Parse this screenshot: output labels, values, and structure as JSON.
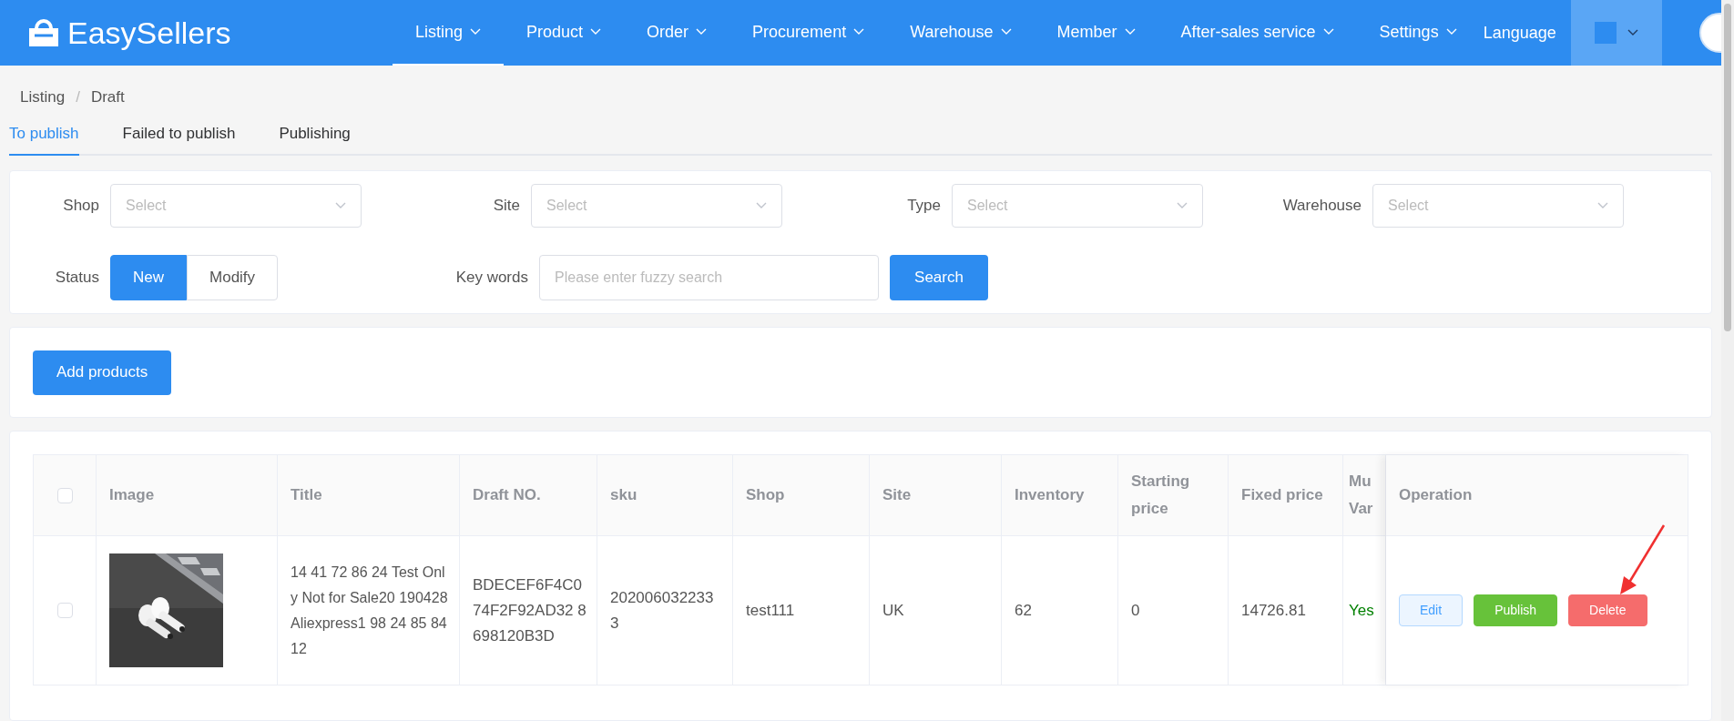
{
  "header": {
    "logo": "EasySellers",
    "nav": [
      {
        "label": "Listing",
        "selected": true
      },
      {
        "label": "Product",
        "selected": false
      },
      {
        "label": "Order",
        "selected": false
      },
      {
        "label": "Procurement",
        "selected": false
      },
      {
        "label": "Warehouse",
        "selected": false
      },
      {
        "label": "Member",
        "selected": false
      },
      {
        "label": "After-sales service",
        "selected": false
      },
      {
        "label": "Settings",
        "selected": false
      }
    ],
    "language": "Language"
  },
  "breadcrumb": {
    "items": [
      "Listing",
      "Draft"
    ],
    "separator": "/"
  },
  "tabs": [
    {
      "label": "To publish",
      "selected": true
    },
    {
      "label": "Failed to publish",
      "selected": false
    },
    {
      "label": "Publishing",
      "selected": false
    }
  ],
  "filters": {
    "selects": [
      {
        "label": "Shop",
        "placeholder": "Select"
      },
      {
        "label": "Site",
        "placeholder": "Select"
      },
      {
        "label": "Type",
        "placeholder": "Select"
      },
      {
        "label": "Warehouse",
        "placeholder": "Select"
      }
    ],
    "status": {
      "label": "Status",
      "options": [
        {
          "label": "New",
          "selected": true
        },
        {
          "label": "Modify",
          "selected": false
        }
      ]
    },
    "keywords": {
      "label": "Key words",
      "placeholder": "Please enter fuzzy search"
    },
    "search_button": "Search"
  },
  "add_button": "Add products",
  "table": {
    "all_checked": false,
    "columns": [
      "Image",
      "Title",
      "Draft NO.",
      "sku",
      "Shop",
      "Site",
      "Inventory",
      "Starting price",
      "Fixed price",
      "Mu\nVar",
      "Operation"
    ],
    "rows": [
      {
        "checked": false,
        "image": {
          "kind": "picture"
        },
        "title": "14 41 72 86 24 Test Only Not for Sale20 190428 Aliexpress1 98 24 85 84 12",
        "draft_no": "BDECEF6F4C0 74F2F92AD32 8698120B3D",
        "sku": "202006032233 3",
        "shop": "test111",
        "site": "UK",
        "inventory": "62",
        "starting_price": "0",
        "fixed_price": "14726.81",
        "multi_variant": "Yes",
        "actions": [
          {
            "label": "Edit",
            "kind": "edit"
          },
          {
            "label": "Publish",
            "kind": "publish"
          },
          {
            "label": "Delete",
            "kind": "delete"
          }
        ]
      }
    ]
  }
}
